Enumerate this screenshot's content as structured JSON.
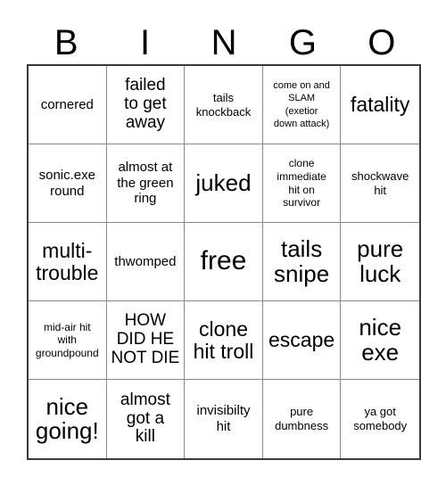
{
  "card": {
    "title": "BINGO Card",
    "header_letters": [
      "B",
      "I",
      "N",
      "G",
      "O"
    ],
    "grid": {
      "columns": 5,
      "rows": 5,
      "border_color": "#3b3b3b",
      "gridline_color": "#8a8a8a",
      "background": "#ffffff",
      "text_color": "#000000"
    },
    "cells": [
      {
        "text": "cornered",
        "size": "m"
      },
      {
        "text": "failed\nto get\naway",
        "size": "l"
      },
      {
        "text": "tails\nknockback",
        "size": "s"
      },
      {
        "text": "come on and\nSLAM\n(exetior\ndown attack)",
        "size": "xxs"
      },
      {
        "text": "fatality",
        "size": "xl"
      },
      {
        "text": "sonic.exe\nround",
        "size": "m"
      },
      {
        "text": "almost at\nthe green\nring",
        "size": "m"
      },
      {
        "text": "juked",
        "size": "xxl"
      },
      {
        "text": "clone\nimmediate\nhit on\nsurvivor",
        "size": "xs"
      },
      {
        "text": "shockwave\nhit",
        "size": "s"
      },
      {
        "text": "multi-\ntrouble",
        "size": "xl"
      },
      {
        "text": "thwomped",
        "size": "m"
      },
      {
        "text": "free",
        "size": "huge"
      },
      {
        "text": "tails\nsnipe",
        "size": "xxl"
      },
      {
        "text": "pure\nluck",
        "size": "xxl"
      },
      {
        "text": "mid-air hit\nwith\ngroundpound",
        "size": "xs"
      },
      {
        "text": "HOW\nDID HE\nNOT DIE",
        "size": "l"
      },
      {
        "text": "clone\nhit troll",
        "size": "xl"
      },
      {
        "text": "escape",
        "size": "xl"
      },
      {
        "text": "nice\nexe",
        "size": "xxl"
      },
      {
        "text": "nice\ngoing!",
        "size": "xxl"
      },
      {
        "text": "almost\ngot a\nkill",
        "size": "l"
      },
      {
        "text": "invisibilty\nhit",
        "size": "m"
      },
      {
        "text": "pure\ndumbness",
        "size": "s"
      },
      {
        "text": "ya got\nsomebody",
        "size": "s"
      }
    ]
  }
}
